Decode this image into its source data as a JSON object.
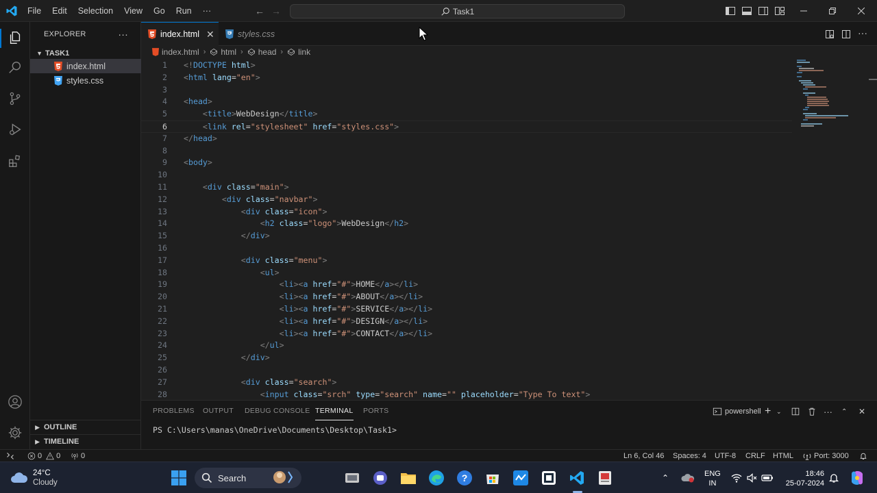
{
  "titlebar": {
    "menus": [
      "File",
      "Edit",
      "Selection",
      "View",
      "Go",
      "Run",
      "···"
    ],
    "command_center": "Task1"
  },
  "sidebar": {
    "title": "EXPLORER",
    "more": "···",
    "folder": "TASK1",
    "files": [
      {
        "name": "index.html",
        "type": "html"
      },
      {
        "name": "styles.css",
        "type": "css"
      }
    ],
    "outline": "OUTLINE",
    "timeline": "TIMELINE"
  },
  "tabs": [
    {
      "label": "index.html",
      "type": "html",
      "active": true
    },
    {
      "label": "styles.css",
      "type": "css",
      "active": false
    }
  ],
  "breadcrumbs": [
    "index.html",
    "html",
    "head",
    "link"
  ],
  "editor": {
    "current_line": 6,
    "lines": [
      [
        [
          "t",
          "<!"
        ],
        [
          "tag",
          "DOCTYPE"
        ],
        [
          "attr",
          " html"
        ],
        [
          "t",
          ">"
        ]
      ],
      [
        [
          "t",
          "<"
        ],
        [
          "tag",
          "html"
        ],
        [
          "attr",
          " lang"
        ],
        [
          "txt",
          "="
        ],
        [
          "str",
          "\"en\""
        ],
        [
          "t",
          ">"
        ]
      ],
      [],
      [
        [
          "t",
          "<"
        ],
        [
          "tag",
          "head"
        ],
        [
          "t",
          ">"
        ]
      ],
      [
        [
          "txt",
          "    "
        ],
        [
          "t",
          "<"
        ],
        [
          "tag",
          "title"
        ],
        [
          "t",
          ">"
        ],
        [
          "txt",
          "WebDesign"
        ],
        [
          "t",
          "</"
        ],
        [
          "tag",
          "title"
        ],
        [
          "t",
          ">"
        ]
      ],
      [
        [
          "txt",
          "    "
        ],
        [
          "t",
          "<"
        ],
        [
          "tag",
          "link"
        ],
        [
          "attr",
          " rel"
        ],
        [
          "txt",
          "="
        ],
        [
          "str",
          "\"stylesheet\""
        ],
        [
          "attr",
          " href"
        ],
        [
          "txt",
          "="
        ],
        [
          "str",
          "\"styles.css\""
        ],
        [
          "t",
          ">"
        ]
      ],
      [
        [
          "t",
          "</"
        ],
        [
          "tag",
          "head"
        ],
        [
          "t",
          ">"
        ]
      ],
      [],
      [
        [
          "t",
          "<"
        ],
        [
          "tag",
          "body"
        ],
        [
          "t",
          ">"
        ]
      ],
      [],
      [
        [
          "txt",
          "    "
        ],
        [
          "t",
          "<"
        ],
        [
          "tag",
          "div"
        ],
        [
          "attr",
          " class"
        ],
        [
          "txt",
          "="
        ],
        [
          "str",
          "\"main\""
        ],
        [
          "t",
          ">"
        ]
      ],
      [
        [
          "txt",
          "        "
        ],
        [
          "t",
          "<"
        ],
        [
          "tag",
          "div"
        ],
        [
          "attr",
          " class"
        ],
        [
          "txt",
          "="
        ],
        [
          "str",
          "\"navbar\""
        ],
        [
          "t",
          ">"
        ]
      ],
      [
        [
          "txt",
          "            "
        ],
        [
          "t",
          "<"
        ],
        [
          "tag",
          "div"
        ],
        [
          "attr",
          " class"
        ],
        [
          "txt",
          "="
        ],
        [
          "str",
          "\"icon\""
        ],
        [
          "t",
          ">"
        ]
      ],
      [
        [
          "txt",
          "                "
        ],
        [
          "t",
          "<"
        ],
        [
          "tag",
          "h2"
        ],
        [
          "attr",
          " class"
        ],
        [
          "txt",
          "="
        ],
        [
          "str",
          "\"logo\""
        ],
        [
          "t",
          ">"
        ],
        [
          "txt",
          "WebDesign"
        ],
        [
          "t",
          "</"
        ],
        [
          "tag",
          "h2"
        ],
        [
          "t",
          ">"
        ]
      ],
      [
        [
          "txt",
          "            "
        ],
        [
          "t",
          "</"
        ],
        [
          "tag",
          "div"
        ],
        [
          "t",
          ">"
        ]
      ],
      [],
      [
        [
          "txt",
          "            "
        ],
        [
          "t",
          "<"
        ],
        [
          "tag",
          "div"
        ],
        [
          "attr",
          " class"
        ],
        [
          "txt",
          "="
        ],
        [
          "str",
          "\"menu\""
        ],
        [
          "t",
          ">"
        ]
      ],
      [
        [
          "txt",
          "                "
        ],
        [
          "t",
          "<"
        ],
        [
          "tag",
          "ul"
        ],
        [
          "t",
          ">"
        ]
      ],
      [
        [
          "txt",
          "                    "
        ],
        [
          "t",
          "<"
        ],
        [
          "tag",
          "li"
        ],
        [
          "t",
          "><"
        ],
        [
          "tag",
          "a"
        ],
        [
          "attr",
          " href"
        ],
        [
          "txt",
          "="
        ],
        [
          "str",
          "\"#\""
        ],
        [
          "t",
          ">"
        ],
        [
          "txt",
          "HOME"
        ],
        [
          "t",
          "</"
        ],
        [
          "tag",
          "a"
        ],
        [
          "t",
          "></"
        ],
        [
          "tag",
          "li"
        ],
        [
          "t",
          ">"
        ]
      ],
      [
        [
          "txt",
          "                    "
        ],
        [
          "t",
          "<"
        ],
        [
          "tag",
          "li"
        ],
        [
          "t",
          "><"
        ],
        [
          "tag",
          "a"
        ],
        [
          "attr",
          " href"
        ],
        [
          "txt",
          "="
        ],
        [
          "str",
          "\"#\""
        ],
        [
          "t",
          ">"
        ],
        [
          "txt",
          "ABOUT"
        ],
        [
          "t",
          "</"
        ],
        [
          "tag",
          "a"
        ],
        [
          "t",
          "></"
        ],
        [
          "tag",
          "li"
        ],
        [
          "t",
          ">"
        ]
      ],
      [
        [
          "txt",
          "                    "
        ],
        [
          "t",
          "<"
        ],
        [
          "tag",
          "li"
        ],
        [
          "t",
          "><"
        ],
        [
          "tag",
          "a"
        ],
        [
          "attr",
          " href"
        ],
        [
          "txt",
          "="
        ],
        [
          "str",
          "\"#\""
        ],
        [
          "t",
          ">"
        ],
        [
          "txt",
          "SERVICE"
        ],
        [
          "t",
          "</"
        ],
        [
          "tag",
          "a"
        ],
        [
          "t",
          "></"
        ],
        [
          "tag",
          "li"
        ],
        [
          "t",
          ">"
        ]
      ],
      [
        [
          "txt",
          "                    "
        ],
        [
          "t",
          "<"
        ],
        [
          "tag",
          "li"
        ],
        [
          "t",
          "><"
        ],
        [
          "tag",
          "a"
        ],
        [
          "attr",
          " href"
        ],
        [
          "txt",
          "="
        ],
        [
          "str",
          "\"#\""
        ],
        [
          "t",
          ">"
        ],
        [
          "txt",
          "DESIGN"
        ],
        [
          "t",
          "</"
        ],
        [
          "tag",
          "a"
        ],
        [
          "t",
          "></"
        ],
        [
          "tag",
          "li"
        ],
        [
          "t",
          ">"
        ]
      ],
      [
        [
          "txt",
          "                    "
        ],
        [
          "t",
          "<"
        ],
        [
          "tag",
          "li"
        ],
        [
          "t",
          "><"
        ],
        [
          "tag",
          "a"
        ],
        [
          "attr",
          " href"
        ],
        [
          "txt",
          "="
        ],
        [
          "str",
          "\"#\""
        ],
        [
          "t",
          ">"
        ],
        [
          "txt",
          "CONTACT"
        ],
        [
          "t",
          "</"
        ],
        [
          "tag",
          "a"
        ],
        [
          "t",
          "></"
        ],
        [
          "tag",
          "li"
        ],
        [
          "t",
          ">"
        ]
      ],
      [
        [
          "txt",
          "                "
        ],
        [
          "t",
          "</"
        ],
        [
          "tag",
          "ul"
        ],
        [
          "t",
          ">"
        ]
      ],
      [
        [
          "txt",
          "            "
        ],
        [
          "t",
          "</"
        ],
        [
          "tag",
          "div"
        ],
        [
          "t",
          ">"
        ]
      ],
      [],
      [
        [
          "txt",
          "            "
        ],
        [
          "t",
          "<"
        ],
        [
          "tag",
          "div"
        ],
        [
          "attr",
          " class"
        ],
        [
          "txt",
          "="
        ],
        [
          "str",
          "\"search\""
        ],
        [
          "t",
          ">"
        ]
      ],
      [
        [
          "txt",
          "                "
        ],
        [
          "t",
          "<"
        ],
        [
          "tag",
          "input"
        ],
        [
          "attr",
          " class"
        ],
        [
          "txt",
          "="
        ],
        [
          "str",
          "\"srch\""
        ],
        [
          "attr",
          " type"
        ],
        [
          "txt",
          "="
        ],
        [
          "str",
          "\"search\""
        ],
        [
          "attr",
          " name"
        ],
        [
          "txt",
          "="
        ],
        [
          "str",
          "\"\""
        ],
        [
          "attr",
          " placeholder"
        ],
        [
          "txt",
          "="
        ],
        [
          "str",
          "\"Type To text\""
        ],
        [
          "t",
          ">"
        ]
      ]
    ]
  },
  "panel": {
    "tabs": [
      "PROBLEMS",
      "OUTPUT",
      "DEBUG CONSOLE",
      "TERMINAL",
      "PORTS"
    ],
    "active_tab": "TERMINAL",
    "shell": "powershell",
    "terminal_line": "PS C:\\Users\\manas\\OneDrive\\Documents\\Desktop\\Task1>"
  },
  "statusbar": {
    "errors": "0",
    "warnings": "0",
    "ports_count": "0",
    "position": "Ln 6, Col 46",
    "spaces": "Spaces: 4",
    "encoding": "UTF-8",
    "eol": "CRLF",
    "language": "HTML",
    "port": "Port: 3000"
  },
  "taskbar": {
    "weather_temp": "24°C",
    "weather_desc": "Cloudy",
    "search_label": "Search",
    "lang": "ENG",
    "region": "IN",
    "time": "18:46",
    "date": "25-07-2024"
  },
  "colors": {
    "accent": "#0078d4",
    "html_icon": "#e44d26",
    "css_icon": "#42a5f5",
    "tag": "#569cd6",
    "attr": "#9cdcfe",
    "string": "#ce9178"
  }
}
